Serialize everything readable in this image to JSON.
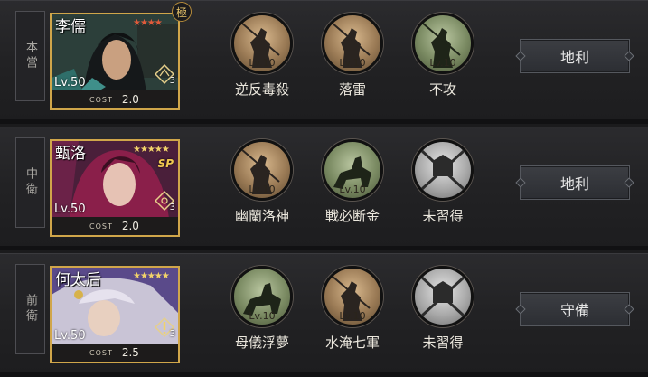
{
  "rows": [
    {
      "position": "本営",
      "hero": {
        "name": "李儒",
        "stars": "★★★★",
        "star_color": "#e05a3a",
        "level": "Lv.50",
        "cost_label": "COST",
        "cost": "2.0",
        "badge_num": "3",
        "rank_mark": "極",
        "sp": ""
      },
      "skills": [
        {
          "name": "逆反毒殺",
          "level": "Lv.10",
          "style": "brown",
          "icon": "spear-soldier-icon"
        },
        {
          "name": "落雷",
          "level": "Lv.10",
          "style": "brown",
          "icon": "spear-soldier-icon"
        },
        {
          "name": "不攻",
          "level": "Lv.10",
          "style": "green",
          "icon": "spear-soldier-icon"
        }
      ],
      "terrain": "地利"
    },
    {
      "position": "中衛",
      "hero": {
        "name": "甄洛",
        "stars": "★★★★★",
        "star_color": "#f2d36a",
        "level": "Lv.50",
        "cost_label": "COST",
        "cost": "2.0",
        "badge_num": "3",
        "rank_mark": "",
        "sp": "SP"
      },
      "skills": [
        {
          "name": "幽蘭洛神",
          "level": "Lv.10",
          "style": "brown",
          "icon": "spear-soldier-icon"
        },
        {
          "name": "戦必断金",
          "level": "Lv.10",
          "style": "green",
          "icon": "cavalry-icon"
        },
        {
          "name": "未習得",
          "level": "",
          "style": "gray",
          "icon": "locked-crossed-swords-icon"
        }
      ],
      "terrain": "地利"
    },
    {
      "position": "前衛",
      "hero": {
        "name": "何太后",
        "stars": "★★★★★",
        "star_color": "#f2d36a",
        "level": "Lv.50",
        "cost_label": "COST",
        "cost": "2.5",
        "badge_num": "3",
        "rank_mark": "",
        "sp": ""
      },
      "skills": [
        {
          "name": "母儀浮夢",
          "level": "Lv.10",
          "style": "green",
          "icon": "cavalry-icon"
        },
        {
          "name": "水淹七軍",
          "level": "Lv.10",
          "style": "brown",
          "icon": "spear-soldier-icon"
        },
        {
          "name": "未習得",
          "level": "",
          "style": "gray",
          "icon": "locked-crossed-swords-icon"
        }
      ],
      "terrain": "守備"
    }
  ]
}
